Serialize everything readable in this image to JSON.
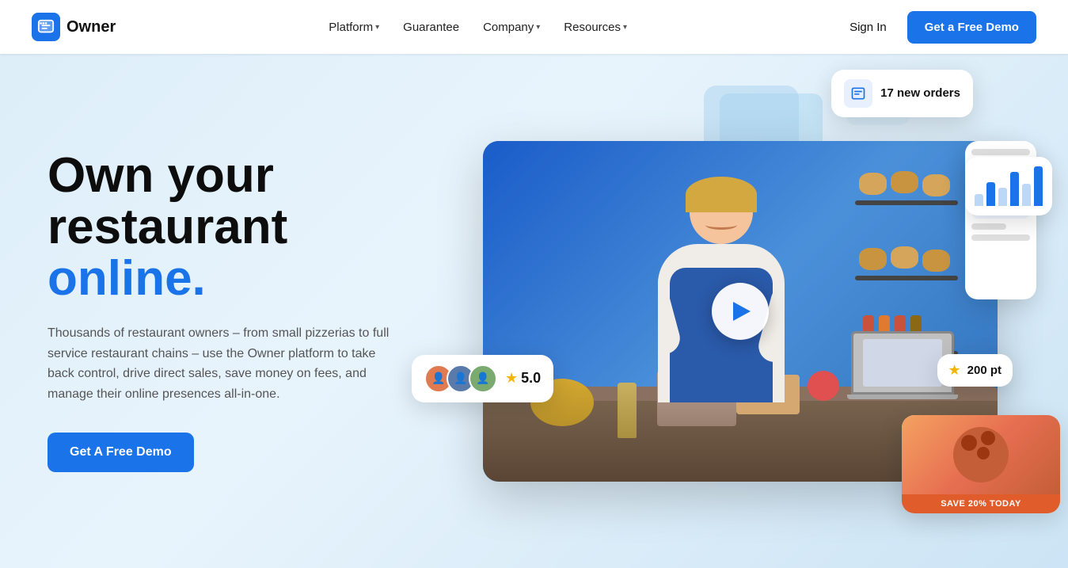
{
  "brand": {
    "name": "Owner",
    "logo_icon": "store-icon"
  },
  "nav": {
    "links": [
      {
        "label": "Platform",
        "has_dropdown": true
      },
      {
        "label": "Guarantee",
        "has_dropdown": false
      },
      {
        "label": "Company",
        "has_dropdown": true
      },
      {
        "label": "Resources",
        "has_dropdown": true
      }
    ],
    "signin_label": "Sign In",
    "demo_label": "Get a Free Demo"
  },
  "hero": {
    "headline_line1": "Own your",
    "headline_line2": "restaurant",
    "headline_accent": "online.",
    "description": "Thousands of restaurant owners – from small pizzerias to full service restaurant chains – use the Owner platform to take back control, drive direct sales, save money on fees, and manage their online presences all-in-one.",
    "cta_label": "Get A Free Demo"
  },
  "floating": {
    "orders": {
      "icon": "orders-icon",
      "text": "17 new orders"
    },
    "rating": {
      "stars": "5.0",
      "star_symbol": "★"
    },
    "save_badge": "SAVE 20% TODAY",
    "points": "200 pt"
  },
  "colors": {
    "primary": "#1a73e8",
    "bg": "#e8f3fb",
    "text_dark": "#0d0d0d",
    "text_muted": "#555555",
    "accent_online": "#1a73e8"
  }
}
